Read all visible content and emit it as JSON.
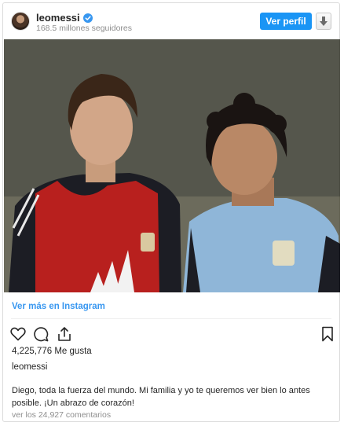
{
  "header": {
    "username": "leomessi",
    "followers": "168.5 millones seguidores",
    "view_profile_label": "Ver perfil",
    "verified_icon": "verified-badge-icon",
    "download_icon": "arrow-down-icon"
  },
  "post": {
    "image_alt_icon": "post-photo",
    "view_more_label": "Ver más en Instagram",
    "likes": "4,225,776 Me gusta",
    "caption_user": "leomessi",
    "caption_line1": "Diego, toda la fuerza del mundo. Mi familia y yo te queremos ver bien lo antes",
    "caption_line2": "posible. ¡Un abrazo de corazón!",
    "comments": "ver los 24,927 comentarios"
  },
  "icons": {
    "like": "heart-icon",
    "comment": "comment-icon",
    "share": "share-icon",
    "save": "bookmark-icon"
  },
  "colors": {
    "accent": "#1a95f5",
    "link": "#3897f0",
    "muted": "#8e8e8e"
  }
}
